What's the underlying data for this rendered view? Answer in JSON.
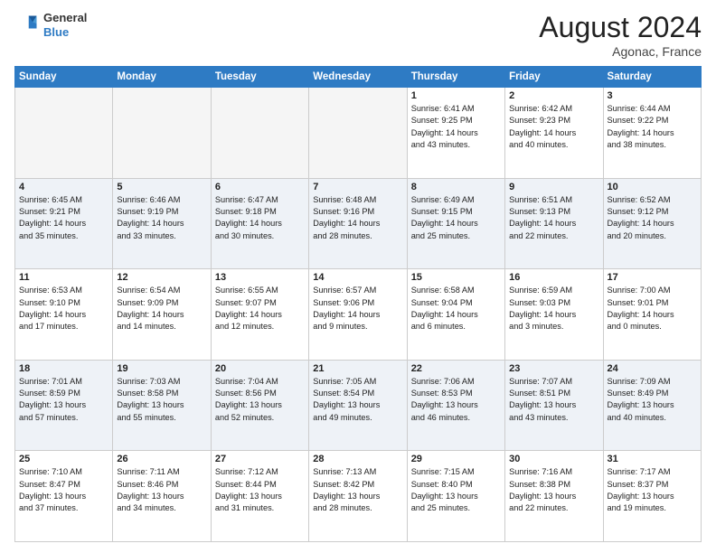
{
  "header": {
    "logo_line1": "General",
    "logo_line2": "Blue",
    "main_title": "August 2024",
    "subtitle": "Agonac, France"
  },
  "weekdays": [
    "Sunday",
    "Monday",
    "Tuesday",
    "Wednesday",
    "Thursday",
    "Friday",
    "Saturday"
  ],
  "weeks": [
    [
      {
        "day": "",
        "info": ""
      },
      {
        "day": "",
        "info": ""
      },
      {
        "day": "",
        "info": ""
      },
      {
        "day": "",
        "info": ""
      },
      {
        "day": "1",
        "info": "Sunrise: 6:41 AM\nSunset: 9:25 PM\nDaylight: 14 hours\nand 43 minutes."
      },
      {
        "day": "2",
        "info": "Sunrise: 6:42 AM\nSunset: 9:23 PM\nDaylight: 14 hours\nand 40 minutes."
      },
      {
        "day": "3",
        "info": "Sunrise: 6:44 AM\nSunset: 9:22 PM\nDaylight: 14 hours\nand 38 minutes."
      }
    ],
    [
      {
        "day": "4",
        "info": "Sunrise: 6:45 AM\nSunset: 9:21 PM\nDaylight: 14 hours\nand 35 minutes."
      },
      {
        "day": "5",
        "info": "Sunrise: 6:46 AM\nSunset: 9:19 PM\nDaylight: 14 hours\nand 33 minutes."
      },
      {
        "day": "6",
        "info": "Sunrise: 6:47 AM\nSunset: 9:18 PM\nDaylight: 14 hours\nand 30 minutes."
      },
      {
        "day": "7",
        "info": "Sunrise: 6:48 AM\nSunset: 9:16 PM\nDaylight: 14 hours\nand 28 minutes."
      },
      {
        "day": "8",
        "info": "Sunrise: 6:49 AM\nSunset: 9:15 PM\nDaylight: 14 hours\nand 25 minutes."
      },
      {
        "day": "9",
        "info": "Sunrise: 6:51 AM\nSunset: 9:13 PM\nDaylight: 14 hours\nand 22 minutes."
      },
      {
        "day": "10",
        "info": "Sunrise: 6:52 AM\nSunset: 9:12 PM\nDaylight: 14 hours\nand 20 minutes."
      }
    ],
    [
      {
        "day": "11",
        "info": "Sunrise: 6:53 AM\nSunset: 9:10 PM\nDaylight: 14 hours\nand 17 minutes."
      },
      {
        "day": "12",
        "info": "Sunrise: 6:54 AM\nSunset: 9:09 PM\nDaylight: 14 hours\nand 14 minutes."
      },
      {
        "day": "13",
        "info": "Sunrise: 6:55 AM\nSunset: 9:07 PM\nDaylight: 14 hours\nand 12 minutes."
      },
      {
        "day": "14",
        "info": "Sunrise: 6:57 AM\nSunset: 9:06 PM\nDaylight: 14 hours\nand 9 minutes."
      },
      {
        "day": "15",
        "info": "Sunrise: 6:58 AM\nSunset: 9:04 PM\nDaylight: 14 hours\nand 6 minutes."
      },
      {
        "day": "16",
        "info": "Sunrise: 6:59 AM\nSunset: 9:03 PM\nDaylight: 14 hours\nand 3 minutes."
      },
      {
        "day": "17",
        "info": "Sunrise: 7:00 AM\nSunset: 9:01 PM\nDaylight: 14 hours\nand 0 minutes."
      }
    ],
    [
      {
        "day": "18",
        "info": "Sunrise: 7:01 AM\nSunset: 8:59 PM\nDaylight: 13 hours\nand 57 minutes."
      },
      {
        "day": "19",
        "info": "Sunrise: 7:03 AM\nSunset: 8:58 PM\nDaylight: 13 hours\nand 55 minutes."
      },
      {
        "day": "20",
        "info": "Sunrise: 7:04 AM\nSunset: 8:56 PM\nDaylight: 13 hours\nand 52 minutes."
      },
      {
        "day": "21",
        "info": "Sunrise: 7:05 AM\nSunset: 8:54 PM\nDaylight: 13 hours\nand 49 minutes."
      },
      {
        "day": "22",
        "info": "Sunrise: 7:06 AM\nSunset: 8:53 PM\nDaylight: 13 hours\nand 46 minutes."
      },
      {
        "day": "23",
        "info": "Sunrise: 7:07 AM\nSunset: 8:51 PM\nDaylight: 13 hours\nand 43 minutes."
      },
      {
        "day": "24",
        "info": "Sunrise: 7:09 AM\nSunset: 8:49 PM\nDaylight: 13 hours\nand 40 minutes."
      }
    ],
    [
      {
        "day": "25",
        "info": "Sunrise: 7:10 AM\nSunset: 8:47 PM\nDaylight: 13 hours\nand 37 minutes."
      },
      {
        "day": "26",
        "info": "Sunrise: 7:11 AM\nSunset: 8:46 PM\nDaylight: 13 hours\nand 34 minutes."
      },
      {
        "day": "27",
        "info": "Sunrise: 7:12 AM\nSunset: 8:44 PM\nDaylight: 13 hours\nand 31 minutes."
      },
      {
        "day": "28",
        "info": "Sunrise: 7:13 AM\nSunset: 8:42 PM\nDaylight: 13 hours\nand 28 minutes."
      },
      {
        "day": "29",
        "info": "Sunrise: 7:15 AM\nSunset: 8:40 PM\nDaylight: 13 hours\nand 25 minutes."
      },
      {
        "day": "30",
        "info": "Sunrise: 7:16 AM\nSunset: 8:38 PM\nDaylight: 13 hours\nand 22 minutes."
      },
      {
        "day": "31",
        "info": "Sunrise: 7:17 AM\nSunset: 8:37 PM\nDaylight: 13 hours\nand 19 minutes."
      }
    ]
  ]
}
